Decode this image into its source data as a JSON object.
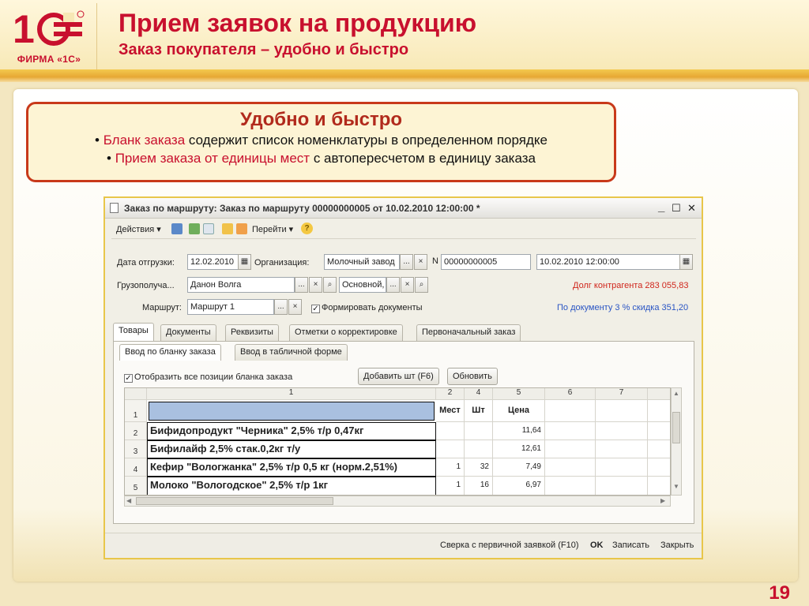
{
  "slide": {
    "title": "Прием заявок на продукцию",
    "subtitle": "Заказ покупателя – удобно и быстро",
    "logo_text": "ФИРМА «1С»",
    "page_number": "19"
  },
  "callout": {
    "title": "Удобно и быстро",
    "line1_bullet": "• ",
    "line1_accent": "Бланк заказа",
    "line1_rest": " содержит список номенклатуры в определенном порядке",
    "line2_bullet": "• ",
    "line2_accent": "Прием заказа от единицы мест",
    "line2_rest": " с автопересчетом в единицу заказа"
  },
  "window": {
    "title": "Заказ по маршруту: Заказ по маршруту 00000000005 от 10.02.2010 12:00:00 *",
    "controls": {
      "minimize": "_",
      "maximize": "☐",
      "close": "✕"
    },
    "toolbar": {
      "actions": "Действия ▾",
      "goto": "Перейти ▾",
      "help": "?"
    },
    "form": {
      "ship_date_label": "Дата отгрузки:",
      "ship_date_value": "12.02.2010",
      "org_label": "Организация:",
      "org_value": "Молочный завод",
      "n_label": "N",
      "n_value": "00000000005",
      "doc_date_value": "10.02.2010 12:00:00",
      "consignee_label": "Грузополуча...",
      "consignee_value": "Данон Волга",
      "contract_value": "Основной,",
      "debt_note": "Долг контрагента 283 055,83",
      "route_label": "Маршрут:",
      "route_value": "Маршрут 1",
      "form_docs_label": "Формировать документы",
      "discount_note": "По документу 3 % скидка 351,20",
      "btn_dots": "...",
      "btn_clear": "×",
      "btn_search": "🔍"
    },
    "tabs": [
      "Товары",
      "Документы",
      "Реквизиты",
      "Отметки о корректировке",
      "Первоначальный заказ"
    ],
    "subtabs": [
      "Ввод по бланку заказа",
      "Ввод в табличной форме"
    ],
    "show_all_label": "Отобразить все позиции бланка заказа",
    "add_button": "Добавить шт (F6)",
    "refresh_button": "Обновить",
    "grid": {
      "column_numbers": [
        "1",
        "2",
        "4",
        "5",
        "6",
        "7"
      ],
      "captions": [
        "",
        "Мест",
        "Шт",
        "Цена",
        "",
        ""
      ],
      "rows": [
        {
          "num": "1",
          "name": "",
          "places": "",
          "pcs": "",
          "price": ""
        },
        {
          "num": "2",
          "name": "Бифидопродукт \"Черника\" 2,5% т/р 0,47кг",
          "places": "",
          "pcs": "",
          "price": "11,64"
        },
        {
          "num": "3",
          "name": "Бифилайф 2,5% стак.0,2кг т/у",
          "places": "",
          "pcs": "",
          "price": "12,61"
        },
        {
          "num": "4",
          "name": "Кефир \"Вологжанка\" 2,5% т/р 0,5 кг (норм.2,51%)",
          "places": "1",
          "pcs": "32",
          "price": "7,49"
        },
        {
          "num": "5",
          "name": "Молоко \"Вологодское\" 2,5% т/р 1кг",
          "places": "1",
          "pcs": "16",
          "price": "6,97"
        }
      ]
    },
    "footer": {
      "check_label": "Сверка с первичной заявкой (F10)",
      "ok": "OK",
      "save": "Записать",
      "close": "Закрыть"
    }
  },
  "colors": {
    "brand_red": "#c8102e",
    "band_yellow": "#e7a834",
    "window_border": "#e8c64a",
    "debt_red": "#d0261c",
    "discount_blue": "#2a55c4"
  }
}
